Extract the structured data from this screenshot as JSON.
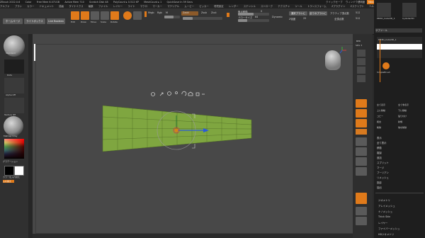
{
  "titlebar": {
    "app": "ZBrush 2022.0.6",
    "items": [
      "Color",
      "Free Mem 6.071GB",
      "Active Mem 710",
      "Scratch Disk 48",
      "PolyCount ▸ 0.512 KP",
      "MeshCount ▸ 1",
      "QuickSave In 59 Secs"
    ],
    "right": [
      "クイックセーブ",
      "ウィンドウ透明度",
      "Menus",
      "DefaultZScript"
    ]
  },
  "menubar": {
    "items": [
      "アルファ",
      "ブラシ",
      "カラー",
      "ドキュメント",
      "描画",
      "ダイナミクス",
      "編集",
      "ファイル",
      "レイヤー",
      "ライト",
      "マクロ",
      "マーカー",
      "マテリアル",
      "ムービー",
      "ピッカー",
      "環境設定",
      "レンダー",
      "ステンシル",
      "ストローク",
      "テクスチャ",
      "ツール",
      "トランスフォーム",
      "Zプラグイン",
      "Zスクリプト",
      "ヘルプ"
    ]
  },
  "topshelf": {
    "home": "ホームページ",
    "lightbox": "ライトボックス",
    "liveboolean": "Live Boolean",
    "btn_edit": "Edit",
    "btn_draw": "Draw",
    "btn_move": "Move",
    "btn_scale": "Scale",
    "btn_rotate": "Rotate",
    "mrgb": "Mrgb",
    "rgb": "Rgb",
    "m": "M",
    "zadd": "Zadd",
    "zsub": "Zsub",
    "zcut": "Zcut",
    "focal_label": "焦点移動",
    "focal_val": "0",
    "draw_size_label": "ドローサイズ",
    "draw_size_val": "64",
    "dynamic": "Dynamic",
    "intensity_label": "Z強度",
    "intensity_val": "25",
    "coord_label": "対称",
    "active_label": "アクティブ頂点数",
    "active_val": "512",
    "total_label": "全頂点数",
    "total_val": "512",
    "buttons_right": [
      "選択ブラシに",
      "全てのブラシに"
    ]
  },
  "leftshelf": {
    "brush_label": "Standard",
    "stroke_label": "Dots",
    "alpha_label": "Alpha Off",
    "texture_label": "Texture Off",
    "material_label": "MatCap Gray",
    "gradient_label": "グラデーション",
    "switch_label": "カラーを入れ替え",
    "alternate": "入れ替え"
  },
  "viewport": {
    "gizmo_icons": [
      "gear-icon",
      "pin-icon",
      "lightbulb-icon",
      "person-icon",
      "undo-icon",
      "home-icon",
      "lock-icon",
      "more-icon"
    ]
  },
  "rightshelf": {
    "labels": [
      "BPR",
      "SPix 3",
      "Scroll",
      "Zoom",
      "Actual",
      "AAHalf",
      "Persp",
      "Floor",
      "Local",
      "Frame",
      "Move",
      "Zoom3D",
      "Rotate",
      "Line Fill PolyF",
      "Transp",
      "Ghost",
      "Solo",
      "Xpose"
    ]
  },
  "rightpanel": {
    "top_items": [
      "PM3D_Cube3D_1",
      "Cylinder3D"
    ],
    "subtool_header": "サブツール",
    "subtool_item": "PM3D_Cube3D_1",
    "simple_brush": "SimpleBrush",
    "list": [
      "表示",
      "全て表示",
      "移動",
      "複製",
      "追加",
      "スプリット",
      "マージ",
      "ブーリアン",
      "リメッシュ",
      "投影",
      "抽出"
    ],
    "list2": [
      "ジオメトリ",
      "アレイメッシュ",
      "ナノメッシュ",
      "Thick Skin",
      "レイヤー",
      "ファイバーメッシュ",
      "HDジオメトリ"
    ],
    "grid_buttons": [
      "全て表示",
      "全て非表示",
      "上に移動",
      "下に移動",
      "コピー",
      "貼り付け",
      "統合",
      "新規",
      "削除",
      "他を削除"
    ]
  },
  "colors": {
    "accent": "#e07a1a",
    "mesh_green": "#7fa640",
    "viewport_bg": "#474747"
  }
}
